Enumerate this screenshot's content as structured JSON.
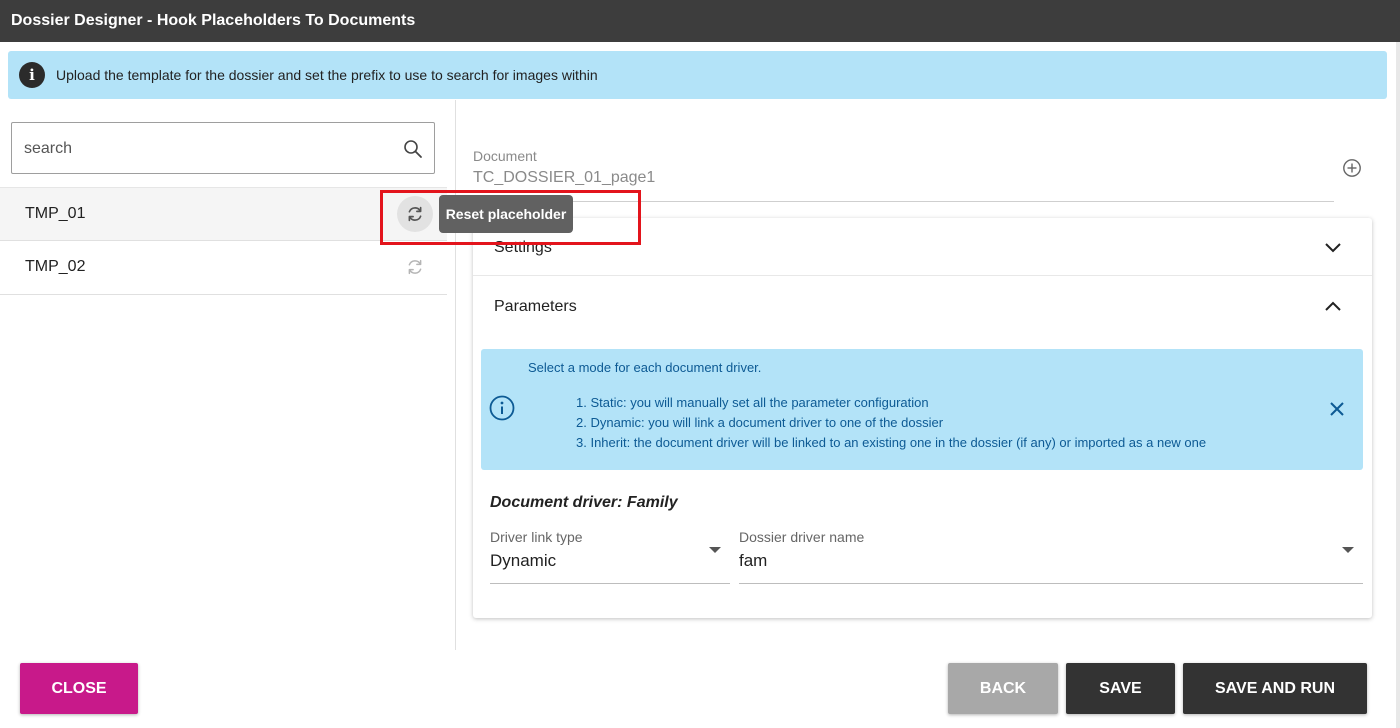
{
  "window": {
    "title": "Dossier Designer - Hook Placeholders To Documents"
  },
  "banner": {
    "text": "Upload the template for the dossier and set the prefix to use to search for images within",
    "icon": "info-icon"
  },
  "search": {
    "placeholder": "search",
    "value": ""
  },
  "placeholders": [
    {
      "name": "TMP_01",
      "selected": true
    },
    {
      "name": "TMP_02",
      "selected": false
    }
  ],
  "tooltip": {
    "text": "Reset placeholder"
  },
  "document": {
    "label": "Document",
    "value": "TC_DOSSIER_01_page1"
  },
  "sections": {
    "settings": "Settings",
    "parameters": "Parameters"
  },
  "param_info": {
    "intro": "Select a mode for each document driver.",
    "items": [
      "1. Static: you will manually set all the parameter configuration",
      "2. Dynamic: you will link a document driver to one of the dossier",
      "3. Inherit: the document driver will be linked to an existing one in the dossier (if any) or imported as a new one"
    ]
  },
  "driver": {
    "title": "Document driver: Family",
    "link_type_label": "Driver link type",
    "link_type_value": "Dynamic",
    "dossier_driver_label": "Dossier driver name",
    "dossier_driver_value": "fam"
  },
  "buttons": {
    "close": "CLOSE",
    "back": "BACK",
    "save": "SAVE",
    "save_and_run": "SAVE AND RUN"
  },
  "colors": {
    "accent": "#c8198a",
    "dark_button": "#333333",
    "info_bg": "#b3e3f8",
    "info_text": "#0d5a94",
    "highlight": "#e3141c"
  }
}
